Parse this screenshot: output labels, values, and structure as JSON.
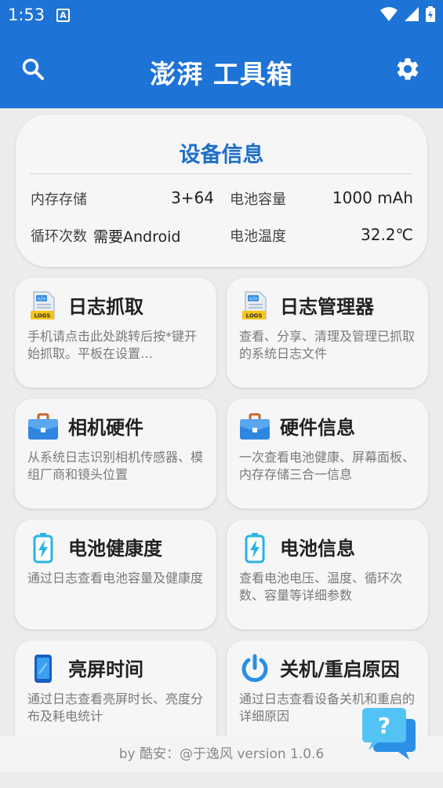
{
  "statusbar": {
    "time": "1:53",
    "notification": "A"
  },
  "appbar": {
    "title": "澎湃 工具箱"
  },
  "device_info": {
    "title": "设备信息",
    "rows": [
      {
        "label1": "内存存储",
        "value1": "3+64",
        "label2": "电池容量",
        "value2": "1000 mAh"
      },
      {
        "label1": "循环次数",
        "value1": "需要Android",
        "label2": "电池温度",
        "value2": "32.2℃"
      }
    ]
  },
  "tiles": [
    {
      "name": "日志抓取",
      "desc": "手机请点击此处跳转后按*键开始抓取。平板在设置…",
      "icon": "logs-file-icon"
    },
    {
      "name": "日志管理器",
      "desc": "查看、分享、清理及管理已抓取的系统日志文件",
      "icon": "logs-file-icon"
    },
    {
      "name": "相机硬件",
      "desc": "从系统日志识别相机传感器、模组厂商和镜头位置",
      "icon": "briefcase-icon"
    },
    {
      "name": "硬件信息",
      "desc": "一次查看电池健康、屏幕面板、内存存储三合一信息",
      "icon": "briefcase-icon"
    },
    {
      "name": "电池健康度",
      "desc": "通过日志查看电池容量及健康度",
      "icon": "battery-charging-icon"
    },
    {
      "name": "电池信息",
      "desc": "查看电池电压、温度、循环次数、容量等详细参数",
      "icon": "battery-charging-icon"
    },
    {
      "name": "亮屏时间",
      "desc": "通过日志查看亮屏时长、亮度分布及耗电统计",
      "icon": "phone-screen-icon"
    },
    {
      "name": "关机/重启原因",
      "desc": "通过日志查看设备关机和重启的详细原因",
      "icon": "power-icon"
    }
  ],
  "footer": {
    "text": "by 酷安：@于逸风 version 1.0.6"
  },
  "fab": {
    "label": "?"
  },
  "colors": {
    "primary": "#1e73d6",
    "accent_title": "#1e6fc9",
    "background": "#ececee"
  }
}
